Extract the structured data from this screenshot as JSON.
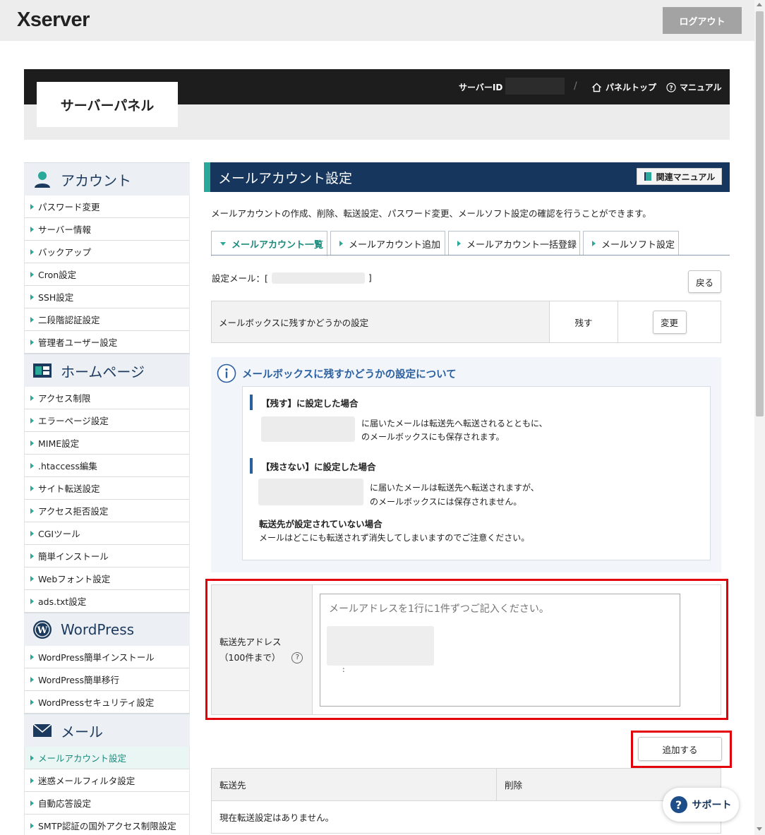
{
  "topbar": {
    "logo": "Xserver",
    "logout_label": "ログアウト"
  },
  "panel_header": {
    "title": "サーバーパネル",
    "server_id_label": "サーバーID",
    "separator": "/",
    "panel_top_label": "パネルトップ",
    "manual_label": "マニュアル"
  },
  "sidebar": {
    "sections": [
      {
        "title": "アカウント",
        "icon": "user-icon",
        "items": [
          "パスワード変更",
          "サーバー情報",
          "バックアップ",
          "Cron設定",
          "SSH設定",
          "二段階認証設定",
          "管理者ユーザー設定"
        ]
      },
      {
        "title": "ホームページ",
        "icon": "layout-icon",
        "items": [
          "アクセス制限",
          "エラーページ設定",
          "MIME設定",
          ".htaccess編集",
          "サイト転送設定",
          "アクセス拒否設定",
          "CGIツール",
          "簡単インストール",
          "Webフォント設定",
          "ads.txt設定"
        ]
      },
      {
        "title": "WordPress",
        "icon": "wordpress-icon",
        "items": [
          "WordPress簡単インストール",
          "WordPress簡単移行",
          "WordPressセキュリティ設定"
        ]
      },
      {
        "title": "メール",
        "icon": "mail-icon",
        "items": [
          "メールアカウント設定",
          "迷惑メールフィルタ設定",
          "自動応答設定",
          "SMTP認証の国外アクセス制限設定"
        ]
      }
    ],
    "active_item": "メールアカウント設定"
  },
  "content": {
    "title": "メールアカウント設定",
    "manual_button": "関連マニュアル",
    "description": "メールアカウントの作成、削除、転送設定、パスワード変更、メールソフト設定の確認を行うことができます。",
    "tabs": [
      "メールアカウント一覧",
      "メールアカウント追加",
      "メールアカウント一括登録",
      "メールソフト設定"
    ],
    "active_tab": "メールアカウント一覧",
    "set_mail_label": "設定メール：[",
    "set_mail_close": "]",
    "back_button": "戻る",
    "keep_setting": {
      "label": "メールボックスに残すかどうかの設定",
      "value": "残す",
      "change_button": "変更"
    },
    "info": {
      "title": "メールボックスに残すかどうかの設定について",
      "keep_heading": "【残す】に設定した場合",
      "keep_line1": "に届いたメールは転送先へ転送されるとともに、",
      "keep_line2": "のメールボックスにも保存されます。",
      "nokeep_heading": "【残さない】に設定した場合",
      "nokeep_line1": "に届いたメールは転送先へ転送されますが、",
      "nokeep_line2": "のメールボックスには保存されません。",
      "nodest_heading": "転送先が設定されていない場合",
      "nodest_text": "メールはどこにも転送されず消失してしまいますのでご注意ください。"
    },
    "forward": {
      "label_line1": "転送先アドレス",
      "label_line2": "（100件まで）",
      "help": "?",
      "placeholder": "メールアドレスを1行に1件ずつご記入ください。",
      "value_fragment": ":",
      "add_button": "追加する"
    },
    "list": {
      "col_dest": "転送先",
      "col_delete": "削除",
      "empty_text": "現在転送設定はありません。"
    }
  },
  "support_label": "サポート",
  "colors": {
    "accent": "#2aa89a",
    "navy": "#17365d",
    "highlight": "#e3000b"
  }
}
